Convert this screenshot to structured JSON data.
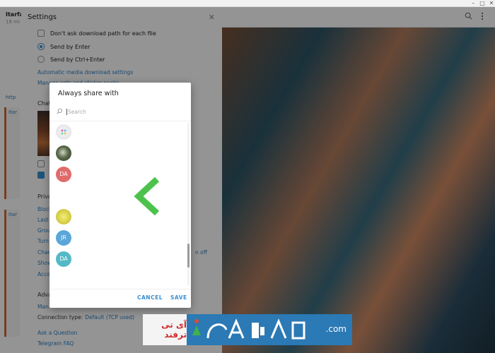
{
  "window": {
    "minimize_glyph": "–",
    "maximize_glyph": "□",
    "close_glyph": "✕"
  },
  "chatlist": {
    "name": "Itarfa",
    "subtitle": "18 mi",
    "link_fragment": "http",
    "card_labels": [
      "Itar",
      "Itar"
    ]
  },
  "settings": {
    "title": "Settings",
    "options": [
      {
        "type": "checkbox",
        "label": "Don't ask download path for each file",
        "checked": false
      },
      {
        "type": "radio",
        "label": "Send by Enter",
        "checked": true
      },
      {
        "type": "radio",
        "label": "Send by Ctrl+Enter",
        "checked": false
      }
    ],
    "links_top": [
      "Automatic media download settings",
      "Manage sets and sticker packs"
    ],
    "section_chat": "Chat",
    "section_privacy": "Priva",
    "privacy_links": [
      "Block",
      "Last",
      "Grou",
      "Turn",
      "Chan",
      "Show",
      "Acco"
    ],
    "privacy_fragment": "n off",
    "section_advanced": "Adva",
    "advanced_link": "Man",
    "connection_label": "Connection type:",
    "connection_value": "Default (TCP used)",
    "bottom_links": [
      "Ask a Question",
      "Telegram FAQ"
    ]
  },
  "dialog": {
    "title": "Always share with",
    "search_placeholder": "Search",
    "search_value": "",
    "contacts": [
      {
        "avatar": "photo",
        "initials": ""
      },
      {
        "avatar": "photo",
        "initials": ""
      },
      {
        "avatar": "initials",
        "initials": "DA",
        "color": "#e06b6b"
      },
      {
        "avatar": "photo",
        "initials": ""
      },
      {
        "avatar": "initials",
        "initials": "JR",
        "color": "#5aa6d8"
      },
      {
        "avatar": "initials",
        "initials": "DA",
        "color": "#54b9c6"
      }
    ],
    "cancel_label": "CANCEL",
    "save_label": "SAVE",
    "arrow_color": "#4cc24c"
  },
  "watermark": {
    "fa_text": "آی تی ترفند",
    "com_text": ".com"
  },
  "colors": {
    "accent": "#3a8fd0",
    "link": "#2e7fbf"
  },
  "icons": {
    "search": "search-icon",
    "menu": "more-vert-icon",
    "close": "close-icon"
  }
}
